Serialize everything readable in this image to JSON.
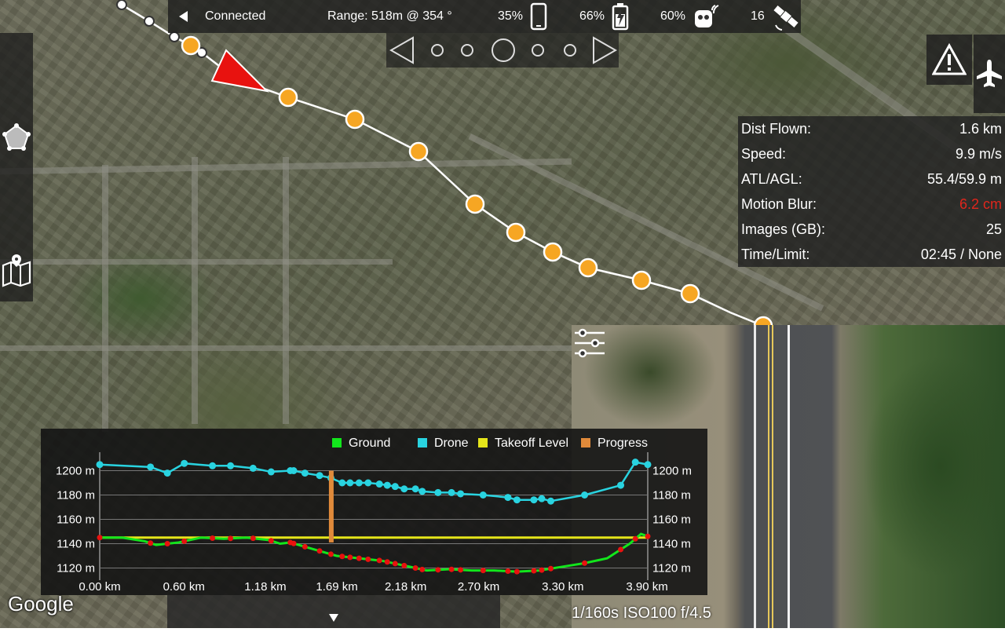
{
  "status": {
    "connection": "Connected",
    "range": "Range: 518m @ 354 °",
    "phone_battery": "35%",
    "drone_battery": "66%",
    "remote_battery": "60%",
    "satellites": "16"
  },
  "telemetry": [
    {
      "label": "Dist Flown:",
      "value": "1.6 km"
    },
    {
      "label": "Speed:",
      "value": "9.9 m/s"
    },
    {
      "label": "ATL/AGL:",
      "value": "55.4/59.9 m"
    },
    {
      "label": "Motion Blur:",
      "value": "6.2 cm",
      "color": "#e0261c"
    },
    {
      "label": "Images (GB):",
      "value": "25"
    },
    {
      "label": "Time/Limit:",
      "value": "02:45 / None"
    }
  ],
  "camera": "1/160s ISO100 f/4.5",
  "google": "Google",
  "colors": {
    "waypoint": "#f6a623",
    "aircraft": "#e8120f",
    "drone_line": "#29d3e0",
    "ground_line": "#12e61c",
    "takeoff_line": "#e5e51a",
    "progress": "#e08a3a"
  },
  "icons": [
    "back-arrow-icon",
    "phone-icon",
    "battery-icon",
    "remote-controller-icon",
    "satellite-icon",
    "warning-icon",
    "airplane-icon",
    "polygon-icon",
    "map-icon",
    "sliders-icon",
    "prev-icon",
    "next-icon",
    "collapse-icon"
  ],
  "chart_data": {
    "type": "line",
    "legend": [
      "Ground",
      "Drone",
      "Takeoff Level",
      "Progress"
    ],
    "x_ticks": [
      "0.00 km",
      "0.60 km",
      "1.18 km",
      "1.69 km",
      "2.18 km",
      "2.70 km",
      "3.30 km",
      "3.90 km"
    ],
    "y_ticks": [
      "1200 m",
      "1180 m",
      "1160 m",
      "1140 m",
      "1120 m"
    ],
    "ylim": [
      1110,
      1210
    ],
    "xlim": [
      0,
      4.0
    ],
    "progress_km": 1.69,
    "takeoff_level": 1145,
    "series": [
      {
        "name": "Drone",
        "points": [
          [
            0.0,
            1205
          ],
          [
            0.45,
            1203
          ],
          [
            0.6,
            1198
          ],
          [
            0.75,
            1206
          ],
          [
            1.0,
            1204
          ],
          [
            1.16,
            1204
          ],
          [
            1.36,
            1202
          ],
          [
            1.52,
            1199
          ],
          [
            1.69,
            1200
          ],
          [
            1.72,
            1200
          ],
          [
            1.82,
            1198
          ],
          [
            1.95,
            1196
          ],
          [
            2.05,
            1194
          ],
          [
            2.15,
            1190
          ],
          [
            2.22,
            1190
          ],
          [
            2.3,
            1190
          ],
          [
            2.38,
            1190
          ],
          [
            2.48,
            1189
          ],
          [
            2.55,
            1188
          ],
          [
            2.62,
            1187
          ],
          [
            2.7,
            1185
          ],
          [
            2.8,
            1185
          ],
          [
            2.86,
            1183
          ],
          [
            3.0,
            1182
          ],
          [
            3.12,
            1182
          ],
          [
            3.2,
            1181
          ],
          [
            3.4,
            1180
          ],
          [
            3.62,
            1178
          ],
          [
            3.7,
            1176
          ],
          [
            3.85,
            1176
          ],
          [
            3.92,
            1177
          ],
          [
            4.0,
            1175
          ],
          [
            4.3,
            1180
          ],
          [
            4.62,
            1188
          ],
          [
            4.75,
            1207
          ],
          [
            4.86,
            1205
          ]
        ]
      },
      {
        "name": "Ground",
        "points": [
          [
            0.0,
            1145
          ],
          [
            0.2,
            1145
          ],
          [
            0.4,
            1142
          ],
          [
            0.5,
            1139
          ],
          [
            0.7,
            1141
          ],
          [
            0.9,
            1145
          ],
          [
            1.1,
            1144
          ],
          [
            1.3,
            1145
          ],
          [
            1.5,
            1143
          ],
          [
            1.6,
            1140
          ],
          [
            1.69,
            1141
          ],
          [
            1.8,
            1138
          ],
          [
            1.95,
            1134
          ],
          [
            2.1,
            1130
          ],
          [
            2.3,
            1128
          ],
          [
            2.5,
            1126
          ],
          [
            2.7,
            1122
          ],
          [
            2.9,
            1118
          ],
          [
            3.1,
            1119
          ],
          [
            3.3,
            1118
          ],
          [
            3.5,
            1118
          ],
          [
            3.7,
            1117
          ],
          [
            3.9,
            1118
          ],
          [
            4.1,
            1121
          ],
          [
            4.3,
            1124
          ],
          [
            4.5,
            1128
          ],
          [
            4.7,
            1140
          ],
          [
            4.8,
            1148
          ],
          [
            4.86,
            1146
          ]
        ]
      }
    ]
  }
}
